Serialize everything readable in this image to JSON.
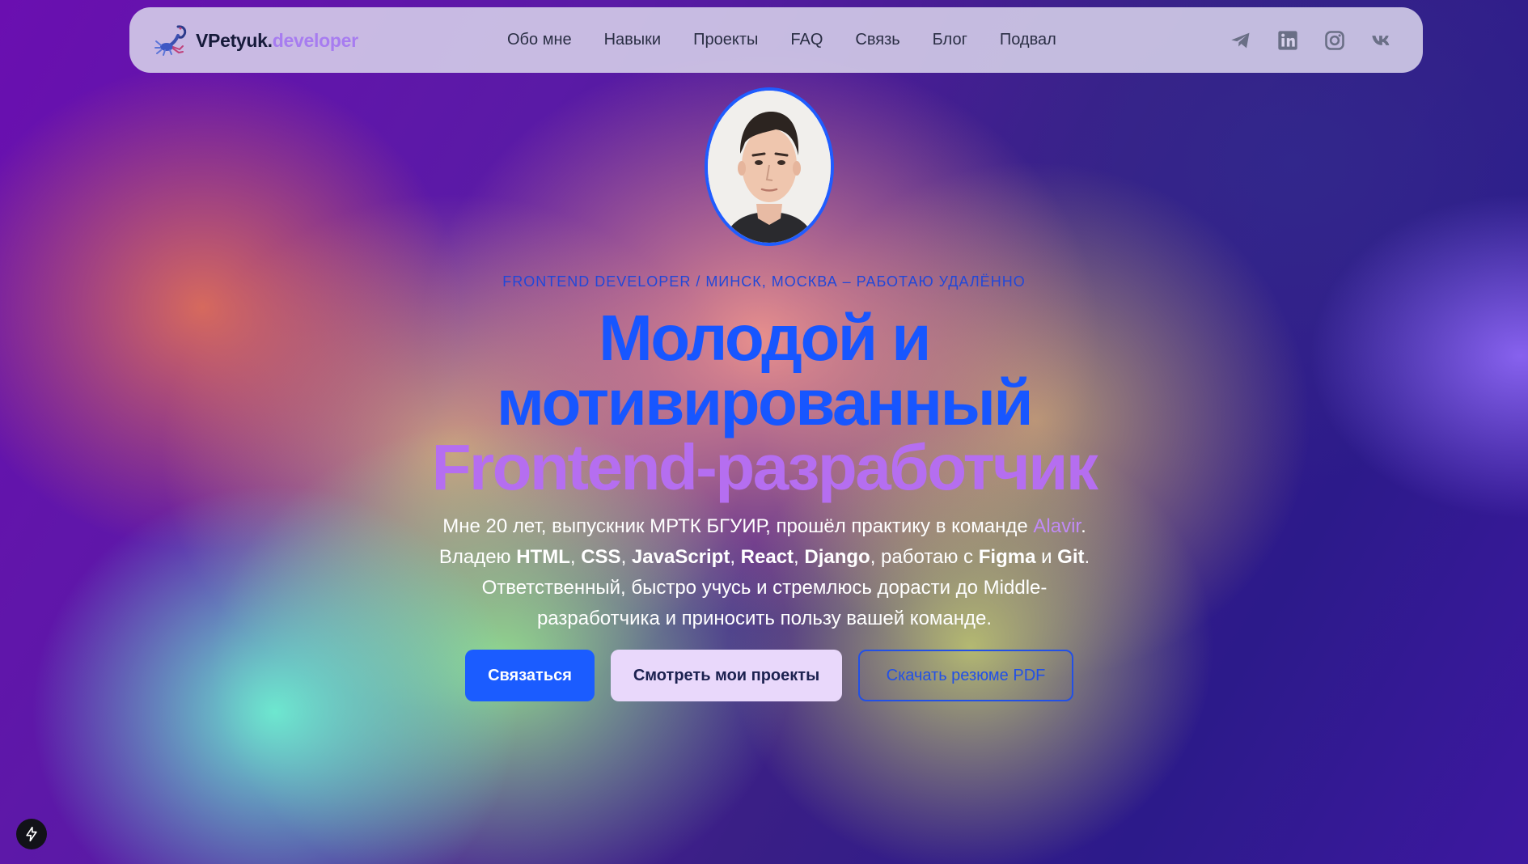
{
  "nav": {
    "logo_name": "VPetyuk.",
    "logo_suffix": "developer",
    "logo_icon": "scorpion-icon",
    "items": [
      {
        "label": "Обо мне"
      },
      {
        "label": "Навыки"
      },
      {
        "label": "Проекты"
      },
      {
        "label": "FAQ"
      },
      {
        "label": "Связь"
      },
      {
        "label": "Блог"
      },
      {
        "label": "Подвал"
      }
    ],
    "socials": [
      "telegram-icon",
      "linkedin-icon",
      "instagram-icon",
      "vk-icon"
    ]
  },
  "hero": {
    "subtitle": "FRONTEND DEVELOPER / МИНСК, МОСКВА – РАБОТАЮ УДАЛЁННО",
    "headline_line1": "Молодой и",
    "headline_line2": "мотивированный",
    "headline_line3": "Frontend-разработчик",
    "desc": {
      "p1": "Мне 20 лет, выпускник МРТК БГУИР, прошёл практику в команде ",
      "company": "Alavir",
      "p2": ". Владею ",
      "s1": "HTML",
      "c1": ", ",
      "s2": "CSS",
      "c2": ", ",
      "s3": "JavaScript",
      "c3": ", ",
      "s4": "React",
      "c4": ", ",
      "s5": "Django",
      "p3": ", работаю с ",
      "s6": "Figma",
      "p4": " и ",
      "s7": "Git",
      "p5": ". Ответственный, быстро учусь и стремлюсь дорасти до Middle-разработчика и приносить пользу вашей команде."
    },
    "buttons": {
      "contact": "Связаться",
      "projects": "Смотреть мои проекты",
      "resume": "Скачать резюме PDF"
    }
  },
  "colors": {
    "accent_blue": "#1756ff",
    "accent_purple": "#b56ef0",
    "nav_bg": "#d7d2eb"
  }
}
